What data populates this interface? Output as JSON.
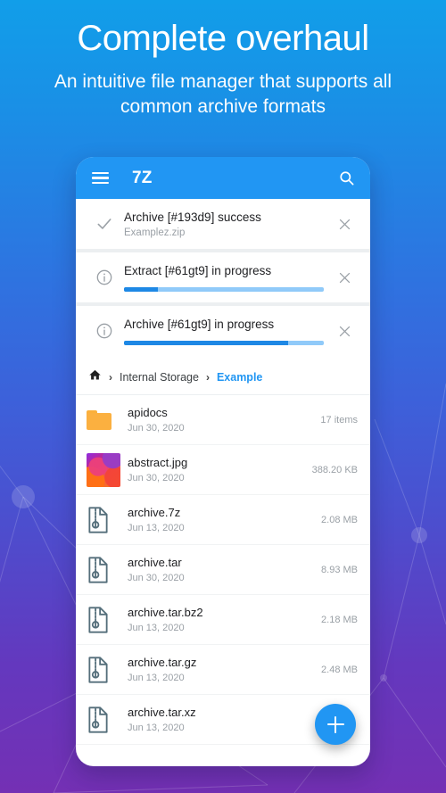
{
  "hero": {
    "title": "Complete overhaul",
    "subtitle": "An intuitive file manager that supports all common archive formats"
  },
  "colors": {
    "accent": "#2196F3",
    "progress_fill": "#1E88E5",
    "progress_track": "#90CAF9",
    "folder": "#FBB040",
    "bg_top": "#119EE9",
    "bg_bottom": "#7430B4",
    "crumb_active": "#2196F3"
  },
  "appbar": {
    "menu_icon": "hamburger-menu-icon",
    "title": "7Z",
    "search_icon": "search-icon"
  },
  "notifications": [
    {
      "status_icon": "check-icon",
      "title": "Archive [#193d9] success",
      "subtitle": "Examplez.zip",
      "close_icon": "close-icon",
      "progress": null
    },
    {
      "status_icon": "info-icon",
      "title": "Extract [#61gt9] in progress",
      "subtitle": "",
      "close_icon": "close-icon",
      "progress": 17
    },
    {
      "status_icon": "info-icon",
      "title": "Archive [#61gt9] in progress",
      "subtitle": "",
      "close_icon": "close-icon",
      "progress": 82
    }
  ],
  "breadcrumb": {
    "home_icon": "home-icon",
    "separator": "›",
    "items": [
      {
        "label": "Internal Storage",
        "active": false
      },
      {
        "label": "Example",
        "active": true
      }
    ]
  },
  "files": [
    {
      "icon": "folder-icon",
      "name": "apidocs",
      "date": "Jun 30, 2020",
      "size": "17 items"
    },
    {
      "icon": "image-thumbnail",
      "name": "abstract.jpg",
      "date": "Jun 30, 2020",
      "size": "388.20 KB"
    },
    {
      "icon": "archive-icon",
      "name": "archive.7z",
      "date": "Jun 13, 2020",
      "size": "2.08 MB"
    },
    {
      "icon": "archive-icon",
      "name": "archive.tar",
      "date": "Jun 30, 2020",
      "size": "8.93 MB"
    },
    {
      "icon": "archive-icon",
      "name": "archive.tar.bz2",
      "date": "Jun 13, 2020",
      "size": "2.18 MB"
    },
    {
      "icon": "archive-icon",
      "name": "archive.tar.gz",
      "date": "Jun 13, 2020",
      "size": "2.48 MB"
    },
    {
      "icon": "archive-icon",
      "name": "archive.tar.xz",
      "date": "Jun 13, 2020",
      "size": ""
    }
  ],
  "fab": {
    "icon": "plus-icon",
    "label": "+"
  }
}
